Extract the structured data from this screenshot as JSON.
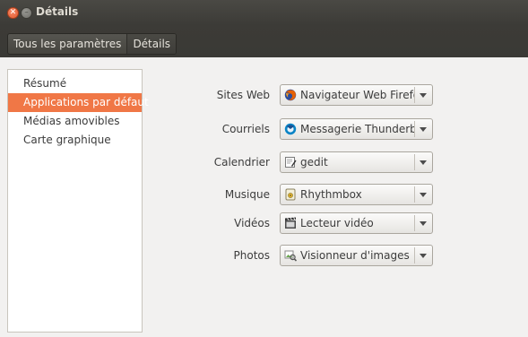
{
  "window": {
    "title": "Détails",
    "close_glyph": "✕",
    "minimize_glyph": "–"
  },
  "breadcrumb": {
    "items": [
      "Tous les paramètres",
      "Détails"
    ]
  },
  "sidebar": {
    "items": [
      {
        "label": "Résumé",
        "selected": false
      },
      {
        "label": "Applications par défaut",
        "selected": true
      },
      {
        "label": "Médias amovibles",
        "selected": false
      },
      {
        "label": "Carte graphique",
        "selected": false
      }
    ]
  },
  "defaults": {
    "rows": [
      {
        "label": "Sites Web",
        "value": "Navigateur Web Firefox",
        "icon": "firefox-icon"
      },
      {
        "label": "Courriels",
        "value": "Messagerie Thunderbird",
        "icon": "thunderbird-icon"
      },
      {
        "label": "Calendrier",
        "value": "gedit",
        "icon": "gedit-icon"
      },
      {
        "label": "Musique",
        "value": "Rhythmbox",
        "icon": "rhythmbox-icon"
      },
      {
        "label": "Vidéos",
        "value": "Lecteur vidéo",
        "icon": "video-player-icon"
      },
      {
        "label": "Photos",
        "value": "Visionneur d'images",
        "icon": "image-viewer-icon"
      }
    ]
  },
  "colors": {
    "accent": "#f07746",
    "titlebar": "#3c3b37",
    "background": "#f2f1f0"
  }
}
